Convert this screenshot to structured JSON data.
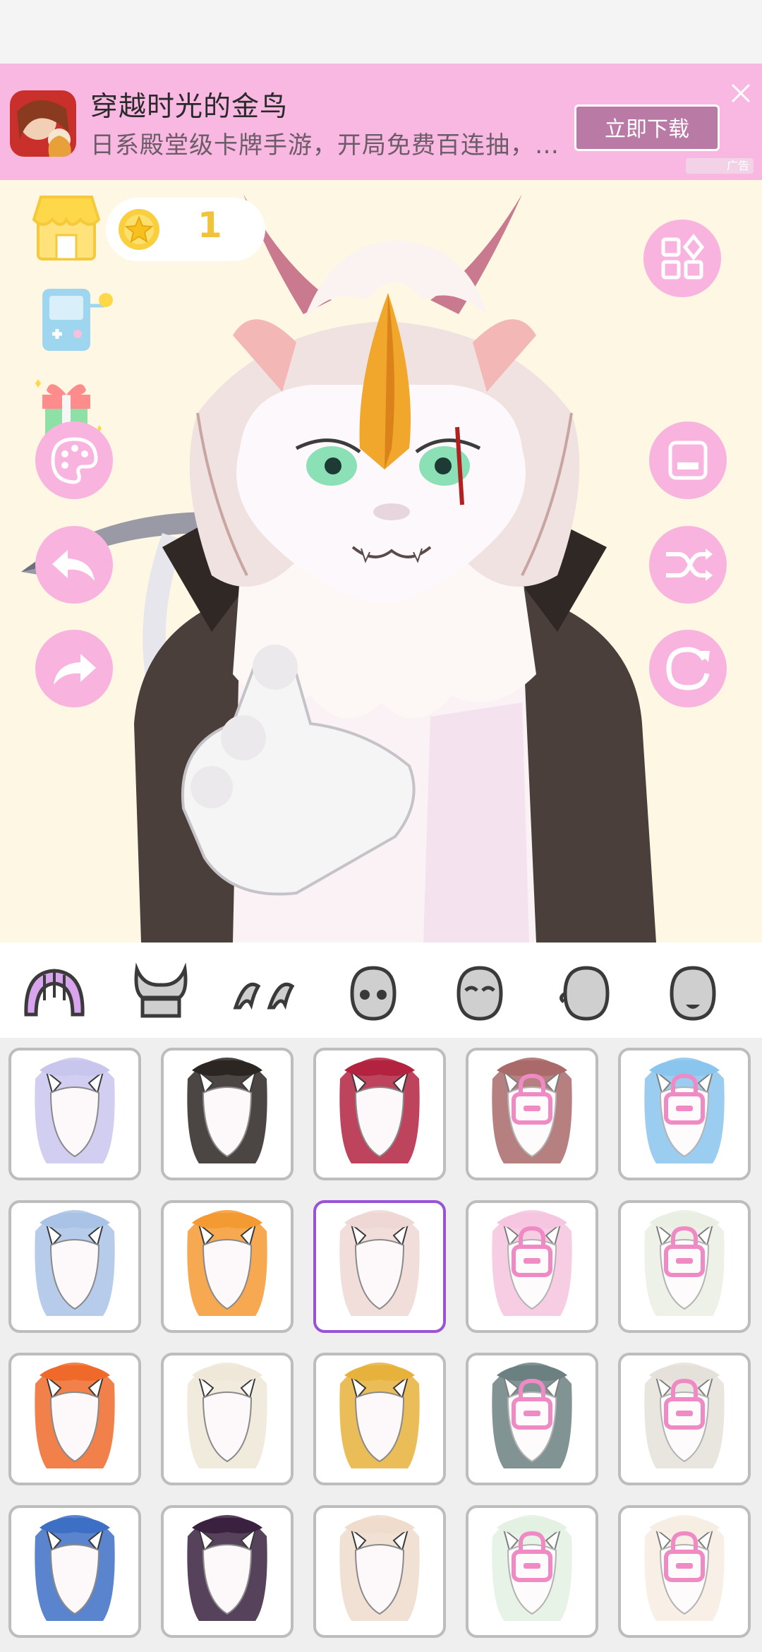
{
  "ad": {
    "title": "穿越时光的金鸟",
    "description": "日系殿堂级卡牌手游，开局免费百连抽，…",
    "button_label": "立即下载",
    "tag": "广告"
  },
  "wallet": {
    "coins": "1"
  },
  "tabs": [
    {
      "name": "hair",
      "selected": true
    },
    {
      "name": "horns",
      "selected": false
    },
    {
      "name": "ears",
      "selected": false
    },
    {
      "name": "eyes",
      "selected": false
    },
    {
      "name": "eyebrows",
      "selected": false
    },
    {
      "name": "nose",
      "selected": false
    },
    {
      "name": "mouth",
      "selected": false
    }
  ],
  "hair_items": [
    {
      "color": "#c9c6ee",
      "locked": false
    },
    {
      "color": "#2b2622",
      "locked": false
    },
    {
      "color": "#b3223f",
      "locked": false
    },
    {
      "color": "#7d1b1b",
      "locked": true
    },
    {
      "color": "#4aa6e3",
      "locked": true
    },
    {
      "color": "#a9c3e6",
      "locked": false
    },
    {
      "color": "#f49a32",
      "locked": false
    },
    {
      "color": "#eed7d4",
      "locked": false,
      "selected": true
    },
    {
      "color": "#f1a6cf",
      "locked": true
    },
    {
      "color": "#dfe6d6",
      "locked": true
    },
    {
      "color": "#ef6a2a",
      "locked": false
    },
    {
      "color": "#efe8d8",
      "locked": false
    },
    {
      "color": "#e7b23b",
      "locked": false
    },
    {
      "color": "#1d3c3e",
      "locked": true
    },
    {
      "color": "#d8d2c6",
      "locked": true
    },
    {
      "color": "#3d6fc4",
      "locked": false
    },
    {
      "color": "#3a2140",
      "locked": false
    },
    {
      "color": "#efdccc",
      "locked": false
    },
    {
      "color": "#d3ead2",
      "locked": true
    },
    {
      "color": "#f2e4d4",
      "locked": true
    }
  ],
  "colors": {
    "accent_pink": "#f8b4df",
    "selected_border": "#9a52d8",
    "lock": "#f08ac4"
  }
}
